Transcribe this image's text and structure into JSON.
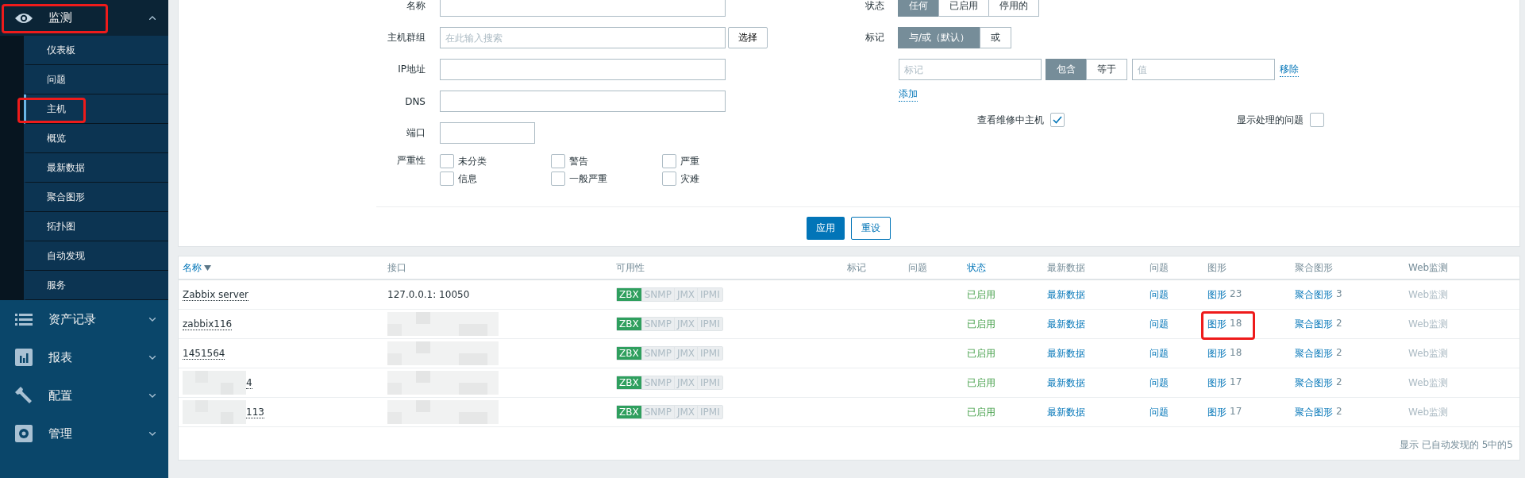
{
  "sidebar": {
    "sections": [
      {
        "label": "监测",
        "expanded": true,
        "highlighted": true,
        "children": [
          {
            "label": "仪表板",
            "selected": false,
            "highlighted": false
          },
          {
            "label": "问题",
            "selected": false,
            "highlighted": false
          },
          {
            "label": "主机",
            "selected": true,
            "highlighted": true
          },
          {
            "label": "概览",
            "selected": false,
            "highlighted": false
          },
          {
            "label": "最新数据",
            "selected": false,
            "highlighted": false
          },
          {
            "label": "聚合图形",
            "selected": false,
            "highlighted": false
          },
          {
            "label": "拓扑图",
            "selected": false,
            "highlighted": false
          },
          {
            "label": "自动发现",
            "selected": false,
            "highlighted": false
          },
          {
            "label": "服务",
            "selected": false,
            "highlighted": false
          }
        ]
      },
      {
        "label": "资产记录",
        "expanded": false,
        "highlighted": false
      },
      {
        "label": "报表",
        "expanded": false,
        "highlighted": false
      },
      {
        "label": "配置",
        "expanded": false,
        "highlighted": false
      },
      {
        "label": "管理",
        "expanded": false,
        "highlighted": false
      }
    ]
  },
  "filter": {
    "fields": [
      {
        "label": "名称",
        "kind": "text"
      },
      {
        "label": "主机群组",
        "kind": "text",
        "placeholder": "在此输入搜索",
        "button": "选择"
      },
      {
        "label": "IP地址",
        "kind": "text"
      },
      {
        "label": "DNS",
        "kind": "text"
      },
      {
        "label": "端口",
        "kind": "short"
      }
    ],
    "severity": {
      "label": "严重性",
      "options": [
        {
          "label": "未分类",
          "checked": false
        },
        {
          "label": "警告",
          "checked": false
        },
        {
          "label": "严重",
          "checked": false
        },
        {
          "label": "信息",
          "checked": false
        },
        {
          "label": "一般严重",
          "checked": false
        },
        {
          "label": "灾难",
          "checked": false
        }
      ]
    },
    "status": {
      "label": "状态",
      "options": [
        {
          "label": "任何",
          "selected": true
        },
        {
          "label": "已启用",
          "selected": false
        },
        {
          "label": "停用的",
          "selected": false
        }
      ]
    },
    "tags": {
      "label": "标记",
      "modes": [
        {
          "label": "与/或（默认）",
          "selected": true
        },
        {
          "label": "或",
          "selected": false
        }
      ],
      "rows": [
        {
          "tag_placeholder": "标记",
          "operators": [
            {
              "label": "包含",
              "selected": true
            },
            {
              "label": "等于",
              "selected": false
            }
          ],
          "value_placeholder": "值",
          "remove": "移除"
        }
      ],
      "add": "添加"
    },
    "checks": [
      {
        "label": "查看维修中主机",
        "checked": true
      },
      {
        "label": "显示处理的问题",
        "checked": false
      }
    ],
    "buttons": [
      {
        "label": "应用",
        "kind": "primary"
      },
      {
        "label": "重设",
        "kind": "secondary"
      }
    ]
  },
  "table": {
    "columns": [
      {
        "label": "名称",
        "kind": "sorted"
      },
      {
        "label": "接口",
        "kind": "plain"
      },
      {
        "label": "可用性",
        "kind": "plain"
      },
      {
        "label": "标记",
        "kind": "plain"
      },
      {
        "label": "问题",
        "kind": "plain"
      },
      {
        "label": "状态",
        "kind": "sortable"
      },
      {
        "label": "最新数据",
        "kind": "plain"
      },
      {
        "label": "问题",
        "kind": "plain"
      },
      {
        "label": "图形",
        "kind": "plain"
      },
      {
        "label": "聚合图形",
        "kind": "plain"
      },
      {
        "label": "Web监测",
        "kind": "plain"
      }
    ],
    "rows": [
      {
        "name": "Zabbix server",
        "name_redacted": false,
        "interface": "127.0.0.1: 10050",
        "interface_redacted": false,
        "availability": [
          {
            "label": "ZBX",
            "on": true
          },
          {
            "label": "SNMP",
            "on": false
          },
          {
            "label": "JMX",
            "on": false
          },
          {
            "label": "IPMI",
            "on": false
          }
        ],
        "status": "已启用",
        "latest": "最新数据",
        "problems": "问题",
        "graphs": {
          "label": "图形",
          "count": "23",
          "highlighted": false
        },
        "screens": {
          "label": "聚合图形",
          "count": "3"
        },
        "web": "Web监测"
      },
      {
        "name": "zabbix116",
        "name_redacted": false,
        "interface_redacted": true,
        "availability": [
          {
            "label": "ZBX",
            "on": true
          },
          {
            "label": "SNMP",
            "on": false
          },
          {
            "label": "JMX",
            "on": false
          },
          {
            "label": "IPMI",
            "on": false
          }
        ],
        "status": "已启用",
        "latest": "最新数据",
        "problems": "问题",
        "graphs": {
          "label": "图形",
          "count": "18",
          "highlighted": true
        },
        "screens": {
          "label": "聚合图形",
          "count": "2"
        },
        "web": "Web监测"
      },
      {
        "name": "1451564",
        "name_redacted": false,
        "interface_redacted": true,
        "availability": [
          {
            "label": "ZBX",
            "on": true
          },
          {
            "label": "SNMP",
            "on": false
          },
          {
            "label": "JMX",
            "on": false
          },
          {
            "label": "IPMI",
            "on": false
          }
        ],
        "status": "已启用",
        "latest": "最新数据",
        "problems": "问题",
        "graphs": {
          "label": "图形",
          "count": "18",
          "highlighted": false
        },
        "screens": {
          "label": "聚合图形",
          "count": "2"
        },
        "web": "Web监测"
      },
      {
        "name": "4",
        "name_redacted": true,
        "interface_redacted": true,
        "availability": [
          {
            "label": "ZBX",
            "on": true
          },
          {
            "label": "SNMP",
            "on": false
          },
          {
            "label": "JMX",
            "on": false
          },
          {
            "label": "IPMI",
            "on": false
          }
        ],
        "status": "已启用",
        "latest": "最新数据",
        "problems": "问题",
        "graphs": {
          "label": "图形",
          "count": "17",
          "highlighted": false
        },
        "screens": {
          "label": "聚合图形",
          "count": "2"
        },
        "web": "Web监测"
      },
      {
        "name": "113",
        "name_redacted": true,
        "interface_redacted": true,
        "availability": [
          {
            "label": "ZBX",
            "on": true
          },
          {
            "label": "SNMP",
            "on": false
          },
          {
            "label": "JMX",
            "on": false
          },
          {
            "label": "IPMI",
            "on": false
          }
        ],
        "status": "已启用",
        "latest": "最新数据",
        "problems": "问题",
        "graphs": {
          "label": "图形",
          "count": "17",
          "highlighted": false
        },
        "screens": {
          "label": "聚合图形",
          "count": "2"
        },
        "web": "Web监测"
      }
    ],
    "footer": "显示 已自动发现的 5中的5"
  }
}
